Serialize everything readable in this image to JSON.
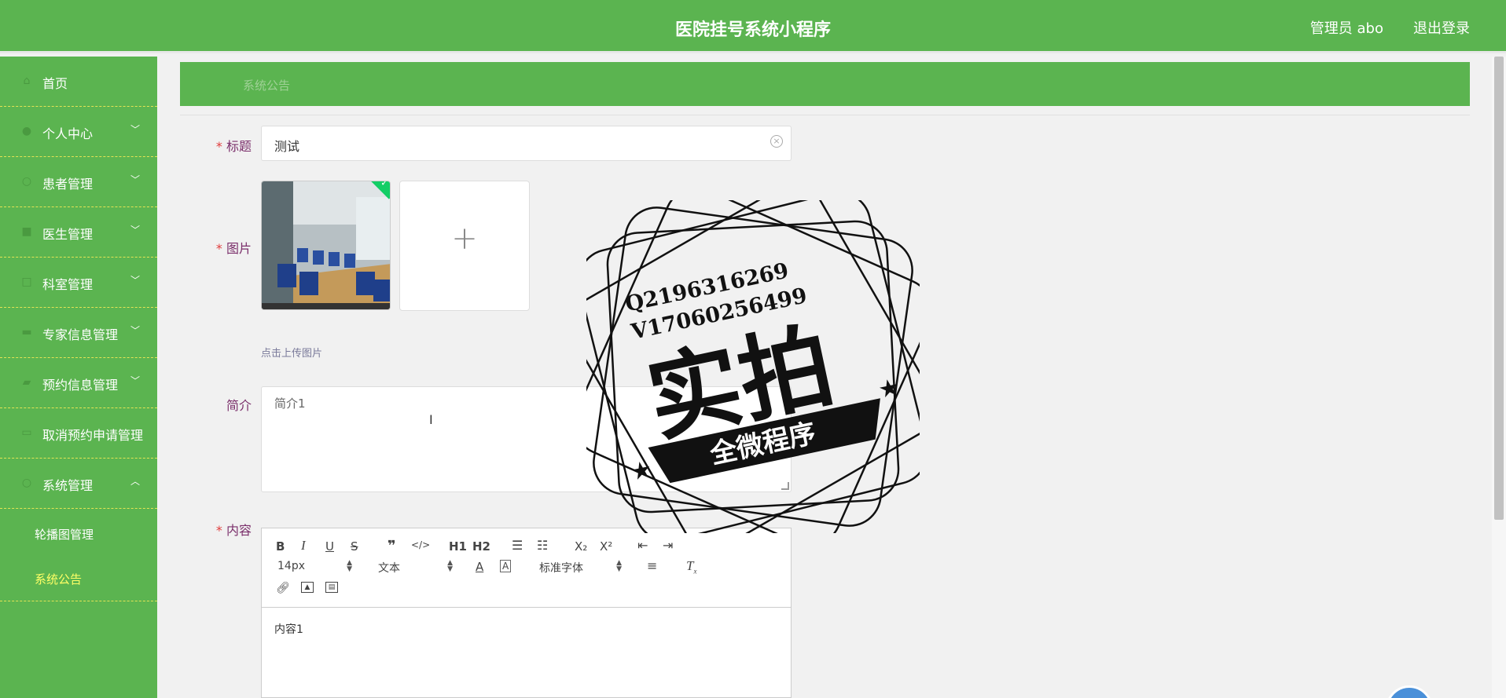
{
  "header": {
    "title": "医院挂号系统小程序",
    "user": "管理员 abo",
    "logout": "退出登录"
  },
  "sidebar": {
    "items": [
      {
        "label": "首页",
        "icon": "home-icon"
      },
      {
        "label": "个人中心",
        "icon": "user-icon",
        "expandable": true
      },
      {
        "label": "患者管理",
        "icon": "patient-icon",
        "expandable": true
      },
      {
        "label": "医生管理",
        "icon": "doctor-icon",
        "expandable": true
      },
      {
        "label": "科室管理",
        "icon": "department-icon",
        "expandable": true
      },
      {
        "label": "专家信息管理",
        "icon": "expert-icon",
        "expandable": true
      },
      {
        "label": "预约信息管理",
        "icon": "appointment-icon",
        "expandable": true
      },
      {
        "label": "取消预约申请管理",
        "icon": "cancel-icon"
      },
      {
        "label": "系统管理",
        "icon": "system-icon",
        "expanded": true
      }
    ],
    "submenu": [
      {
        "label": "轮播图管理"
      },
      {
        "label": "系统公告",
        "active": true
      }
    ]
  },
  "breadcrumb": "系统公告",
  "form": {
    "title_label": "标题",
    "title_value": "测试",
    "image_label": "图片",
    "upload_tip": "点击上传图片",
    "intro_label": "简介",
    "intro_value": "简介1",
    "content_label": "内容",
    "content_value": "内容1"
  },
  "editor": {
    "font_size": "14px",
    "paragraph": "文本",
    "font_family": "标准字体",
    "h1": "H1",
    "h2": "H2",
    "subscript": "X₂",
    "superscript": "X²"
  },
  "watermark": {
    "line1": "Q2196316269",
    "line2": "V17060256499",
    "big": "实拍",
    "banner": "全微程序"
  },
  "colors": {
    "primary": "#5bb450",
    "active_submenu": "#ffff66",
    "label": "#7b2f6b",
    "required": "#e03c3c"
  }
}
